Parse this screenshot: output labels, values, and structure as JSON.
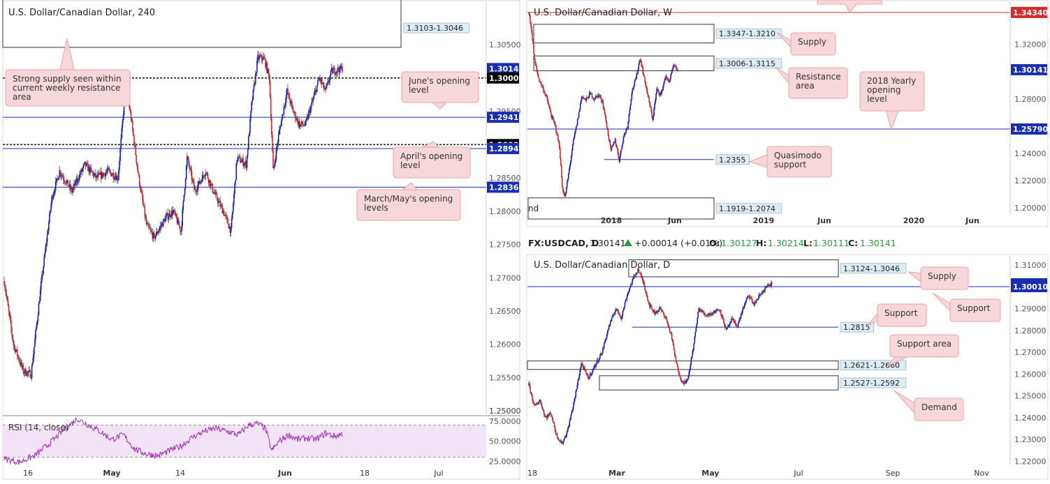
{
  "colors": {
    "bull": "#1919c8",
    "bear": "#e0202a",
    "level": "#1a2fb0",
    "resistance_line": "#d42a2a",
    "rsi_line": "#9c27b0",
    "rsi_fill": "#f3e3f7",
    "callout_fill": "#f7d7d9",
    "callout_stroke": "#e9a3a6",
    "zone_label_fill": "#dcedf5",
    "price_tag_blue": "#1a2fb0",
    "price_tag_black": "#000000",
    "price_tag_red": "#d42a2a"
  },
  "info_bar": {
    "symbol": "FX:USDCAD, D",
    "price": "1.30141",
    "change": "+0.00014 (+0.01%)",
    "o_label": "O:",
    "o_value": "1.30127",
    "h_label": "H:",
    "h_value": "1.30214",
    "l_label": "L:",
    "l_value": "1.30111",
    "c_label": "C:",
    "c_value": "1.30141"
  },
  "chart_data": [
    {
      "id": "h4",
      "type": "candlestick",
      "title": "U.S. Dollar/Canadian Dollar, 240",
      "ylim": [
        1.2495,
        1.3115
      ],
      "y_ticks": [
        "1.30500",
        "1.29500",
        "1.28500",
        "1.28000",
        "1.27500",
        "1.27000",
        "1.26500",
        "1.26000",
        "1.25500",
        "1.25000"
      ],
      "y_tick_values": [
        1.305,
        1.295,
        1.285,
        1.28,
        1.275,
        1.27,
        1.265,
        1.26,
        1.255,
        1.25
      ],
      "x_ticks": [
        "16",
        "May",
        "14",
        "Jun",
        "18",
        "Jul"
      ],
      "price_tags": [
        {
          "text": "1.30141",
          "value": 1.30141,
          "kind": "blue"
        },
        {
          "text": "1.30000",
          "value": 1.3,
          "kind": "black"
        },
        {
          "text": "1.29410",
          "value": 1.2941,
          "kind": "blue"
        },
        {
          "text": "1.29000",
          "value": 1.29,
          "kind": "black"
        },
        {
          "text": "1.28940",
          "value": 1.2894,
          "kind": "blue"
        },
        {
          "text": "1.28360",
          "value": 1.2836,
          "kind": "blue"
        }
      ],
      "levels": [
        {
          "value": 1.3,
          "style": "dashed"
        },
        {
          "value": 1.2941,
          "style": "solid"
        },
        {
          "value": 1.29,
          "style": "dashed"
        },
        {
          "value": 1.2894,
          "style": "solid"
        },
        {
          "value": 1.2836,
          "style": "solid"
        }
      ],
      "zones": [
        {
          "label": "1.3103-1.3046",
          "low": 1.3046,
          "high": 1.3103
        }
      ],
      "callouts": [
        {
          "text": "Strong supply seen within current weekly resistance area",
          "lines": [
            "Strong supply seen within",
            "current weekly resistance",
            "area"
          ]
        },
        {
          "text": "June's opening level",
          "lines": [
            "June's opening",
            "level"
          ]
        },
        {
          "text": "April's opening level",
          "lines": [
            "April's opening",
            "level"
          ]
        },
        {
          "text": "March/May's opening levels",
          "lines": [
            "March/May's opening",
            "levels"
          ]
        }
      ],
      "candles_anchor": [
        [
          0,
          1.2695
        ],
        [
          12,
          1.26
        ],
        [
          25,
          1.256
        ],
        [
          35,
          1.2555
        ],
        [
          48,
          1.269
        ],
        [
          62,
          1.282
        ],
        [
          72,
          1.286
        ],
        [
          88,
          1.283
        ],
        [
          105,
          1.287
        ],
        [
          120,
          1.285
        ],
        [
          135,
          1.286
        ],
        [
          148,
          1.285
        ],
        [
          158,
          1.299
        ],
        [
          165,
          1.294
        ],
        [
          175,
          1.285
        ],
        [
          185,
          1.278
        ],
        [
          195,
          1.276
        ],
        [
          210,
          1.279
        ],
        [
          220,
          1.28
        ],
        [
          230,
          1.277
        ],
        [
          238,
          1.288
        ],
        [
          248,
          1.283
        ],
        [
          262,
          1.286
        ],
        [
          272,
          1.283
        ],
        [
          285,
          1.28
        ],
        [
          295,
          1.277
        ],
        [
          303,
          1.288
        ],
        [
          315,
          1.287
        ],
        [
          322,
          1.296
        ],
        [
          330,
          1.303
        ],
        [
          338,
          1.303
        ],
        [
          345,
          1.3
        ],
        [
          350,
          1.286
        ],
        [
          358,
          1.292
        ],
        [
          368,
          1.298
        ],
        [
          376,
          1.295
        ],
        [
          384,
          1.293
        ],
        [
          392,
          1.293
        ],
        [
          400,
          1.296
        ],
        [
          410,
          1.3
        ],
        [
          418,
          1.298
        ],
        [
          426,
          1.301
        ],
        [
          440,
          1.3014
        ]
      ],
      "rsi": {
        "label": "RSI (14, close)",
        "ylim": [
          21,
          80
        ],
        "y_ticks": [
          "75.0000",
          "50.0000",
          "25.0000"
        ],
        "y_tick_values": [
          75,
          50,
          25
        ],
        "band": [
          30,
          70
        ],
        "values_anchor": [
          [
            0,
            28
          ],
          [
            20,
            24
          ],
          [
            40,
            32
          ],
          [
            60,
            48
          ],
          [
            80,
            66
          ],
          [
            95,
            78
          ],
          [
            110,
            70
          ],
          [
            125,
            62
          ],
          [
            140,
            52
          ],
          [
            155,
            58
          ],
          [
            170,
            40
          ],
          [
            185,
            34
          ],
          [
            200,
            32
          ],
          [
            215,
            38
          ],
          [
            230,
            44
          ],
          [
            245,
            55
          ],
          [
            260,
            62
          ],
          [
            275,
            66
          ],
          [
            290,
            62
          ],
          [
            305,
            58
          ],
          [
            318,
            70
          ],
          [
            330,
            72
          ],
          [
            340,
            66
          ],
          [
            348,
            38
          ],
          [
            358,
            50
          ],
          [
            370,
            58
          ],
          [
            382,
            52
          ],
          [
            394,
            54
          ],
          [
            406,
            52
          ],
          [
            418,
            60
          ],
          [
            430,
            56
          ],
          [
            440,
            59
          ]
        ]
      }
    },
    {
      "id": "weekly",
      "type": "candlestick",
      "title": "U.S. Dollar/Canadian Dollar, W",
      "ylim": [
        1.1955,
        1.3515
      ],
      "y_ticks": [
        "1.32000",
        "1.28000",
        "1.26000",
        "1.24000",
        "1.22000",
        "1.20000"
      ],
      "y_tick_values": [
        1.32,
        1.28,
        1.26,
        1.24,
        1.22,
        1.2
      ],
      "x_ticks": [
        "2018",
        "Jun",
        "2019",
        "Jun",
        "2020",
        "Jun"
      ],
      "price_tags": [
        {
          "text": "1.34340",
          "value": 1.3434,
          "kind": "red"
        },
        {
          "text": "1.30141",
          "value": 1.30141,
          "kind": "blue"
        },
        {
          "text": "1.25790",
          "value": 1.2579,
          "kind": "blue"
        }
      ],
      "levels": [
        {
          "value": 1.3434,
          "style": "solid",
          "kind": "red"
        },
        {
          "value": 1.2579,
          "style": "solid"
        }
      ],
      "zones": [
        {
          "label": "1.3347-1.3210",
          "low": 1.321,
          "high": 1.3347
        },
        {
          "label": "1.3006-1.3115",
          "low": 1.3006,
          "high": 1.3115
        },
        {
          "label": "1.1919-1.2074",
          "low": 1.1919,
          "high": 1.2074
        }
      ],
      "lines": [
        {
          "label": "1.2355",
          "value": 1.2355
        }
      ],
      "callouts": [
        {
          "text": "Supply",
          "lines": [
            "Supply"
          ]
        },
        {
          "text": "Resistance area",
          "lines": [
            "Resistance",
            "area"
          ]
        },
        {
          "text": "2018 Yearly opening level",
          "lines": [
            "2018 Yearly",
            "opening",
            "level"
          ]
        },
        {
          "text": "Quasimodo support",
          "lines": [
            "Quasimodo",
            "support"
          ]
        }
      ],
      "clipped_text": "nd",
      "candles_anchor": [
        [
          0,
          1.343
        ],
        [
          4,
          1.33
        ],
        [
          8,
          1.308
        ],
        [
          14,
          1.295
        ],
        [
          20,
          1.288
        ],
        [
          26,
          1.28
        ],
        [
          32,
          1.268
        ],
        [
          38,
          1.26
        ],
        [
          44,
          1.245
        ],
        [
          48,
          1.215
        ],
        [
          52,
          1.208
        ],
        [
          58,
          1.228
        ],
        [
          64,
          1.249
        ],
        [
          70,
          1.264
        ],
        [
          76,
          1.282
        ],
        [
          82,
          1.279
        ],
        [
          88,
          1.284
        ],
        [
          94,
          1.28
        ],
        [
          100,
          1.283
        ],
        [
          106,
          1.278
        ],
        [
          112,
          1.26
        ],
        [
          118,
          1.242
        ],
        [
          124,
          1.25
        ],
        [
          130,
          1.235
        ],
        [
          136,
          1.252
        ],
        [
          142,
          1.26
        ],
        [
          148,
          1.285
        ],
        [
          154,
          1.295
        ],
        [
          160,
          1.31
        ],
        [
          166,
          1.295
        ],
        [
          172,
          1.28
        ],
        [
          178,
          1.265
        ],
        [
          184,
          1.287
        ],
        [
          190,
          1.283
        ],
        [
          196,
          1.296
        ],
        [
          202,
          1.293
        ],
        [
          208,
          1.304
        ],
        [
          214,
          1.3014
        ]
      ]
    },
    {
      "id": "daily",
      "type": "candlestick",
      "title": "U.S. Dollar/Canadian Dollar, D",
      "ylim": [
        1.2185,
        1.3145
      ],
      "y_ticks": [
        "1.31000",
        "1.29000",
        "1.28000",
        "1.27000",
        "1.26000",
        "1.25000",
        "1.24000",
        "1.23000",
        "1.22000"
      ],
      "y_tick_values": [
        1.31,
        1.29,
        1.28,
        1.27,
        1.26,
        1.25,
        1.24,
        1.23,
        1.22
      ],
      "x_ticks": [
        "18",
        "Mar",
        "May",
        "Jul",
        "Sep",
        "Nov"
      ],
      "price_tags": [
        {
          "text": "1.30141",
          "value": 1.30141,
          "kind": "blue"
        },
        {
          "text": "1.30010",
          "value": 1.3001,
          "kind": "blue"
        }
      ],
      "levels": [
        {
          "value": 1.3001,
          "style": "solid"
        }
      ],
      "zones": [
        {
          "label": "1.3124-1.3046",
          "low": 1.3046,
          "high": 1.3124
        },
        {
          "label": "1.2621-1.2660",
          "low": 1.2621,
          "high": 1.266
        },
        {
          "label": "1.2527-1.2592",
          "low": 1.2527,
          "high": 1.2592
        }
      ],
      "lines": [
        {
          "label": "1.2815",
          "value": 1.2815
        }
      ],
      "callouts": [
        {
          "text": "Supply",
          "lines": [
            "Supply"
          ]
        },
        {
          "text": "Support",
          "lines": [
            "Support"
          ]
        },
        {
          "text": "Support",
          "lines": [
            "Support"
          ]
        },
        {
          "text": "Support area",
          "lines": [
            "Support area"
          ]
        },
        {
          "text": "Demand",
          "lines": [
            "Demand"
          ]
        }
      ],
      "candles_anchor": [
        [
          0,
          1.255
        ],
        [
          8,
          1.245
        ],
        [
          16,
          1.248
        ],
        [
          24,
          1.24
        ],
        [
          32,
          1.242
        ],
        [
          40,
          1.232
        ],
        [
          48,
          1.228
        ],
        [
          56,
          1.234
        ],
        [
          66,
          1.248
        ],
        [
          76,
          1.265
        ],
        [
          86,
          1.258
        ],
        [
          96,
          1.264
        ],
        [
          106,
          1.27
        ],
        [
          116,
          1.282
        ],
        [
          126,
          1.29
        ],
        [
          134,
          1.286
        ],
        [
          142,
          1.296
        ],
        [
          150,
          1.303
        ],
        [
          158,
          1.308
        ],
        [
          166,
          1.302
        ],
        [
          174,
          1.292
        ],
        [
          182,
          1.288
        ],
        [
          190,
          1.29
        ],
        [
          198,
          1.286
        ],
        [
          206,
          1.278
        ],
        [
          214,
          1.264
        ],
        [
          222,
          1.256
        ],
        [
          230,
          1.257
        ],
        [
          238,
          1.272
        ],
        [
          246,
          1.29
        ],
        [
          256,
          1.287
        ],
        [
          266,
          1.288
        ],
        [
          276,
          1.29
        ],
        [
          286,
          1.28
        ],
        [
          294,
          1.285
        ],
        [
          302,
          1.282
        ],
        [
          310,
          1.29
        ],
        [
          318,
          1.296
        ],
        [
          326,
          1.292
        ],
        [
          334,
          1.296
        ],
        [
          344,
          1.3
        ],
        [
          352,
          1.3014
        ]
      ]
    }
  ]
}
